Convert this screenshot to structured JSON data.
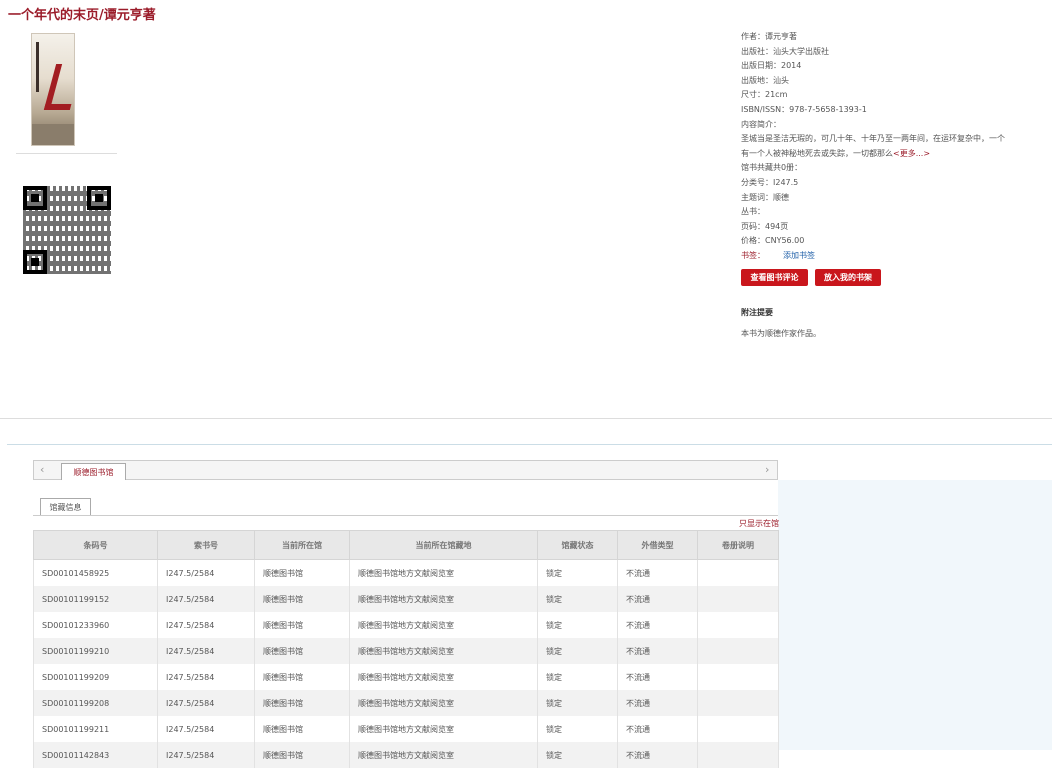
{
  "book": {
    "title": "一个年代的末页/谭元亨著"
  },
  "info": {
    "author": "作者：谭元亨著",
    "publisher": "出版社：汕头大学出版社",
    "pub_date": "出版日期：2014",
    "pub_place": "出版地：汕头",
    "size": "尺寸：21cm",
    "isbn": "ISBN/ISSN：978-7-5658-1393-1",
    "intro_label": "内容简介：",
    "intro_text": "圣城当是圣洁无瑕的，可几十年、十年乃至一两年间，在运环复杂中，一个有一个人被神秘地死去或失踪，一切都那么",
    "more": "<更多...>",
    "copies": "馆书共藏共0册：",
    "class_no": "分类号：I247.5",
    "subject": "主题词：顺德",
    "series": "丛书：",
    "pages": "页码：494页",
    "price": "价格：CNY56.00",
    "bookmark_label": "书签：",
    "bookmark_link": "添加书签"
  },
  "buttons": {
    "review": "查看图书评论",
    "shelf": "放入我的书架"
  },
  "attach": {
    "title": "附注提要",
    "text": "本书为顺德作家作品。"
  },
  "tabs": {
    "library": "顺德图书馆",
    "holdings": "馆藏信息",
    "only_in_lib": "只显示在馆"
  },
  "table": {
    "headers": [
      "条码号",
      "索书号",
      "当前所在馆",
      "当前所在馆藏地",
      "馆藏状态",
      "外借类型",
      "卷册说明"
    ],
    "rows": [
      [
        "SD00101458925",
        "I247.5/2584",
        "顺德图书馆",
        "顺德图书馆地方文献阅览室",
        "锁定",
        "不流通",
        ""
      ],
      [
        "SD00101199152",
        "I247.5/2584",
        "顺德图书馆",
        "顺德图书馆地方文献阅览室",
        "锁定",
        "不流通",
        ""
      ],
      [
        "SD00101233960",
        "I247.5/2584",
        "顺德图书馆",
        "顺德图书馆地方文献阅览室",
        "锁定",
        "不流通",
        ""
      ],
      [
        "SD00101199210",
        "I247.5/2584",
        "顺德图书馆",
        "顺德图书馆地方文献阅览室",
        "锁定",
        "不流通",
        ""
      ],
      [
        "SD00101199209",
        "I247.5/2584",
        "顺德图书馆",
        "顺德图书馆地方文献阅览室",
        "锁定",
        "不流通",
        ""
      ],
      [
        "SD00101199208",
        "I247.5/2584",
        "顺德图书馆",
        "顺德图书馆地方文献阅览室",
        "锁定",
        "不流通",
        ""
      ],
      [
        "SD00101199211",
        "I247.5/2584",
        "顺德图书馆",
        "顺德图书馆地方文献阅览室",
        "锁定",
        "不流通",
        ""
      ],
      [
        "SD00101142843",
        "I247.5/2584",
        "顺德图书馆",
        "顺德图书馆地方文献阅览室",
        "锁定",
        "不流通",
        ""
      ]
    ]
  },
  "colors": {
    "accent": "#9b1c2a",
    "button": "#c9161c",
    "link": "#1f5fa8"
  }
}
